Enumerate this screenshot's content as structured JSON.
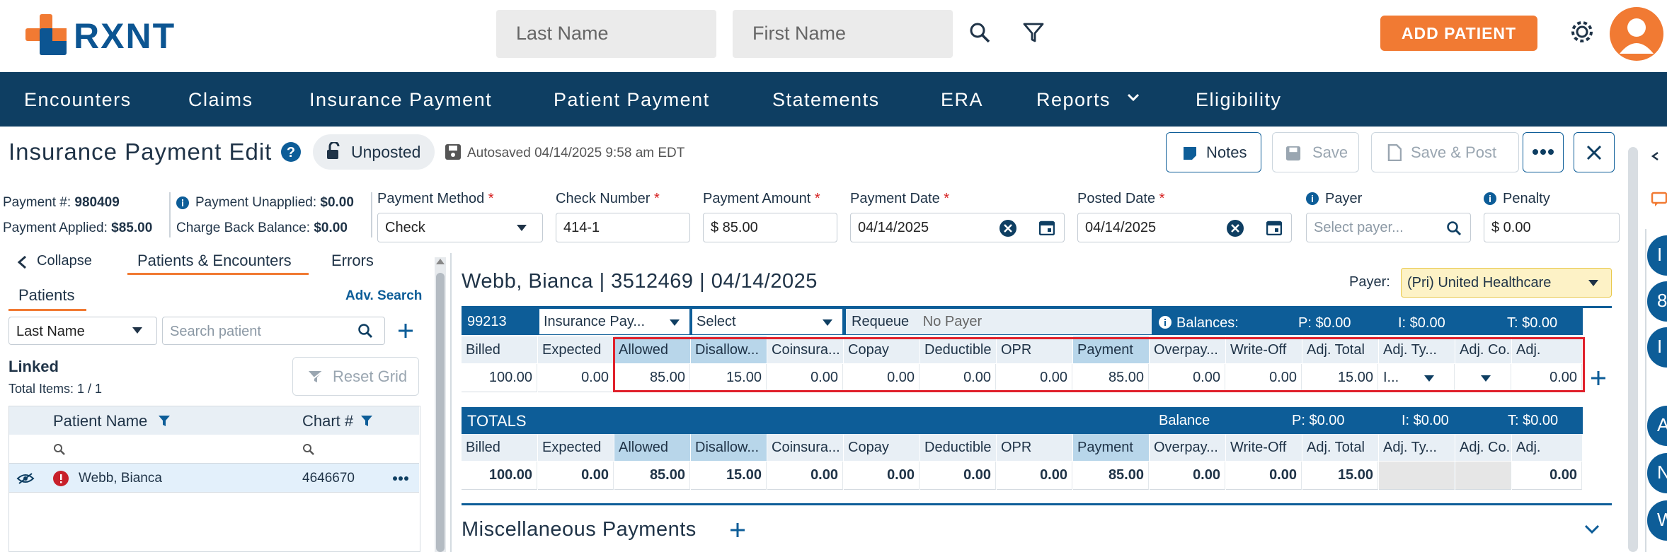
{
  "header": {
    "logo": "RXNT",
    "search_last_name_placeholder": "Last Name",
    "search_first_name_placeholder": "First Name",
    "add_patient": "ADD PATIENT"
  },
  "nav": [
    "Encounters",
    "Claims",
    "Insurance Payment",
    "Patient Payment",
    "Statements",
    "ERA",
    "Reports",
    "Eligibility"
  ],
  "toolbar": {
    "title": "Insurance Payment Edit",
    "status": "Unposted",
    "autosave": "Autosaved 04/14/2025 9:58 am EDT",
    "notes": "Notes",
    "save": "Save",
    "save_post": "Save & Post"
  },
  "summary": {
    "payment_no_label": "Payment #:",
    "payment_no": "980409",
    "applied_label": "Payment Applied:",
    "applied": "$85.00",
    "unapplied_label": "Payment Unapplied:",
    "unapplied": "$0.00",
    "chargeback_label": "Charge Back Balance:",
    "chargeback": "$0.00"
  },
  "form": {
    "method_label": "Payment Method",
    "method_value": "Check",
    "check_label": "Check Number",
    "check_value": "414-1",
    "amount_label": "Payment Amount",
    "amount_value": "$ 85.00",
    "pdate_label": "Payment Date",
    "pdate_value": "04/14/2025",
    "posted_label": "Posted Date",
    "posted_value": "04/14/2025",
    "payer_label": "Payer",
    "payer_placeholder": "Select payer...",
    "penalty_label": "Penalty",
    "penalty_value": "$ 0.00",
    "required": "*"
  },
  "left": {
    "collapse": "Collapse",
    "tab_pe": "Patients & Encounters",
    "tab_err": "Errors",
    "patients": "Patients",
    "adv_search": "Adv. Search",
    "sort_value": "Last Name",
    "search_placeholder": "Search patient",
    "linked": "Linked",
    "total_items": "Total Items: 1 / 1",
    "reset_grid": "Reset Grid",
    "col_name": "Patient Name",
    "col_chart": "Chart #",
    "row_name": "Webb, Bianca",
    "row_chart": "4646670"
  },
  "encounter": {
    "title": "Webb, Bianca | 3512469 | 04/14/2025",
    "payer_label": "Payer:",
    "payer_value": "(Pri) United Healthcare",
    "code": "99213",
    "ins_pay": "Insurance Pay...",
    "select": "Select",
    "requeue": "Requeue",
    "no_payer": "No Payer",
    "balances": "Balances:",
    "bal_p": "P: $0.00",
    "bal_i": "I: $0.00",
    "bal_t": "T: $0.00",
    "columns": [
      "Billed",
      "Expected",
      "Allowed",
      "Disallow...",
      "Coinsura...",
      "Copay",
      "Deductible",
      "OPR",
      "Payment",
      "Overpay...",
      "Write-Off",
      "Adj. Total",
      "Adj. Ty...",
      "Adj. Co...",
      "Adj."
    ],
    "values": [
      "100.00",
      "0.00",
      "85.00",
      "15.00",
      "0.00",
      "0.00",
      "0.00",
      "0.00",
      "85.00",
      "0.00",
      "0.00",
      "15.00",
      "I...",
      "",
      "0.00"
    ]
  },
  "totals": {
    "title": "TOTALS",
    "balance": "Balance",
    "p": "P: $0.00",
    "i": "I: $0.00",
    "t": "T: $0.00",
    "columns": [
      "Billed",
      "Expected",
      "Allowed",
      "Disallow...",
      "Coinsura...",
      "Copay",
      "Deductible",
      "OPR",
      "Payment",
      "Overpay...",
      "Write-Off",
      "Adj. Total",
      "Adj. Ty...",
      "Adj. Co...",
      "Adj."
    ],
    "values": [
      "100.00",
      "0.00",
      "85.00",
      "15.00",
      "0.00",
      "0.00",
      "0.00",
      "0.00",
      "85.00",
      "0.00",
      "0.00",
      "15.00",
      "",
      "",
      "0.00"
    ]
  },
  "misc": {
    "title": "Miscellaneous Payments"
  },
  "right_rail": [
    "I",
    "8",
    "I",
    "A",
    "N",
    "W"
  ],
  "colors": {
    "navy": "#0e3e62",
    "blue": "#0d5d98",
    "orange": "#f17a33",
    "highlight": "#b8d6ea",
    "red_box": "#e0202b"
  }
}
